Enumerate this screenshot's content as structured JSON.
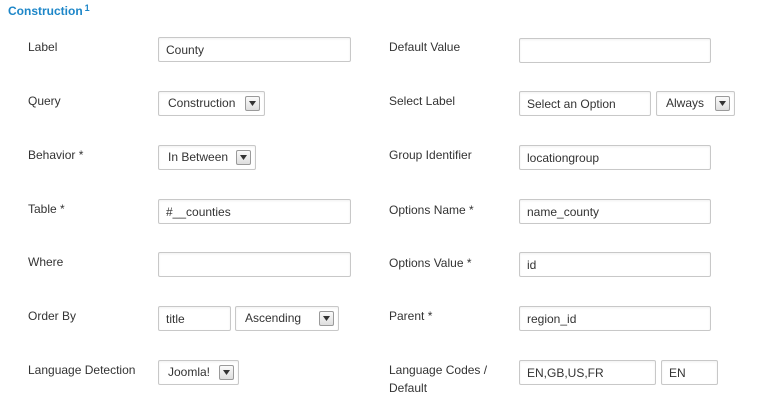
{
  "section": {
    "title": "Construction",
    "marker": "1"
  },
  "fields": {
    "label": {
      "label": "Label",
      "value": "County"
    },
    "default_value": {
      "label": "Default Value",
      "value": ""
    },
    "query": {
      "label": "Query",
      "value": "Construction"
    },
    "select_label": {
      "label": "Select Label",
      "value": "Select an Option",
      "mode": "Always"
    },
    "behavior": {
      "label": "Behavior *",
      "value": "In Between"
    },
    "group_identifier": {
      "label": "Group Identifier",
      "value": "locationgroup"
    },
    "table": {
      "label": "Table *",
      "value": "#__counties"
    },
    "options_name": {
      "label": "Options Name *",
      "value": "name_county"
    },
    "where": {
      "label": "Where",
      "value": ""
    },
    "options_value": {
      "label": "Options Value *",
      "value": "id"
    },
    "order_by": {
      "label": "Order By",
      "value": "title",
      "direction": "Ascending"
    },
    "parent": {
      "label": "Parent *",
      "value": "region_id"
    },
    "language_detection": {
      "label": "Language Detection",
      "value": "Joomla!"
    },
    "language_codes": {
      "label": "Language Codes / Default",
      "value": "EN,GB,US,FR",
      "default": "EN"
    }
  },
  "colors": {
    "accent": "#1d86c8"
  },
  "icons": {
    "dropdown": "chevron-down-icon"
  }
}
